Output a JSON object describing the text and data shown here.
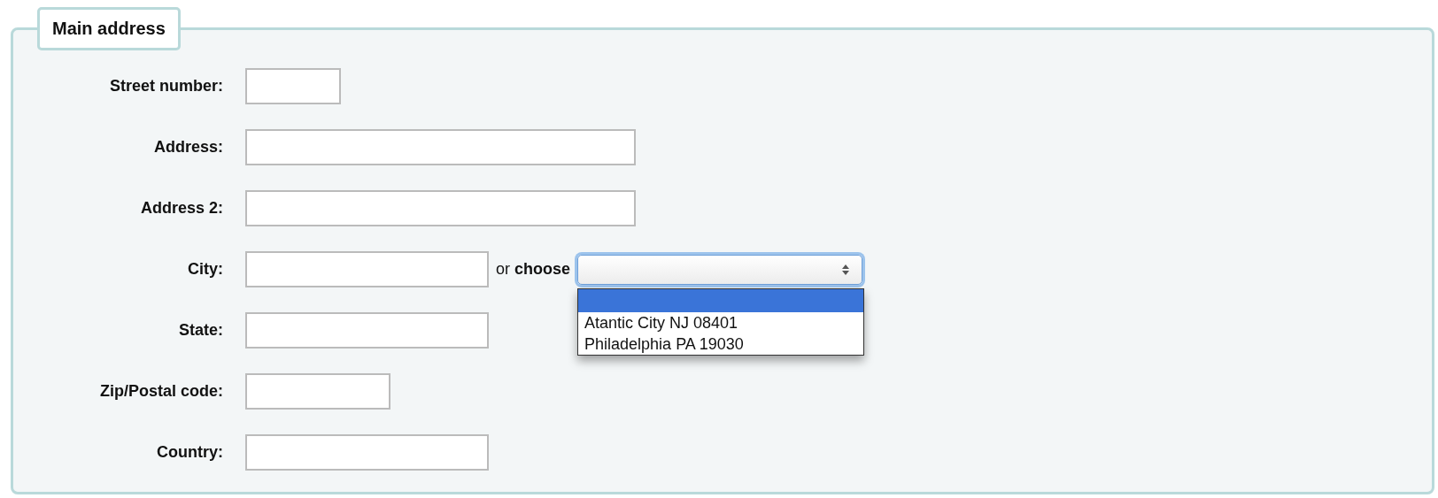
{
  "legend": "Main address",
  "fields": [
    {
      "label": "Street number:",
      "kind": "short"
    },
    {
      "label": "Address:",
      "kind": "long"
    },
    {
      "label": "Address 2:",
      "kind": "long"
    },
    {
      "label": "City:",
      "kind": "medium",
      "alternative": {
        "text": "or **choose**",
        "select": {
          "focused": true,
          "expanded": true,
          "blank_option_highlighted": true,
          "options": [
            {
              "label": "Atantic City NJ 08401",
              "selected": false
            },
            {
              "label": "Philadelphia PA 19030",
              "selected": false
            }
          ]
        }
      }
    },
    {
      "label": "State:",
      "kind": "medium"
    },
    {
      "label": "Zip/Postal code:",
      "kind": "zip"
    },
    {
      "label": "Country:",
      "kind": "medium"
    }
  ]
}
